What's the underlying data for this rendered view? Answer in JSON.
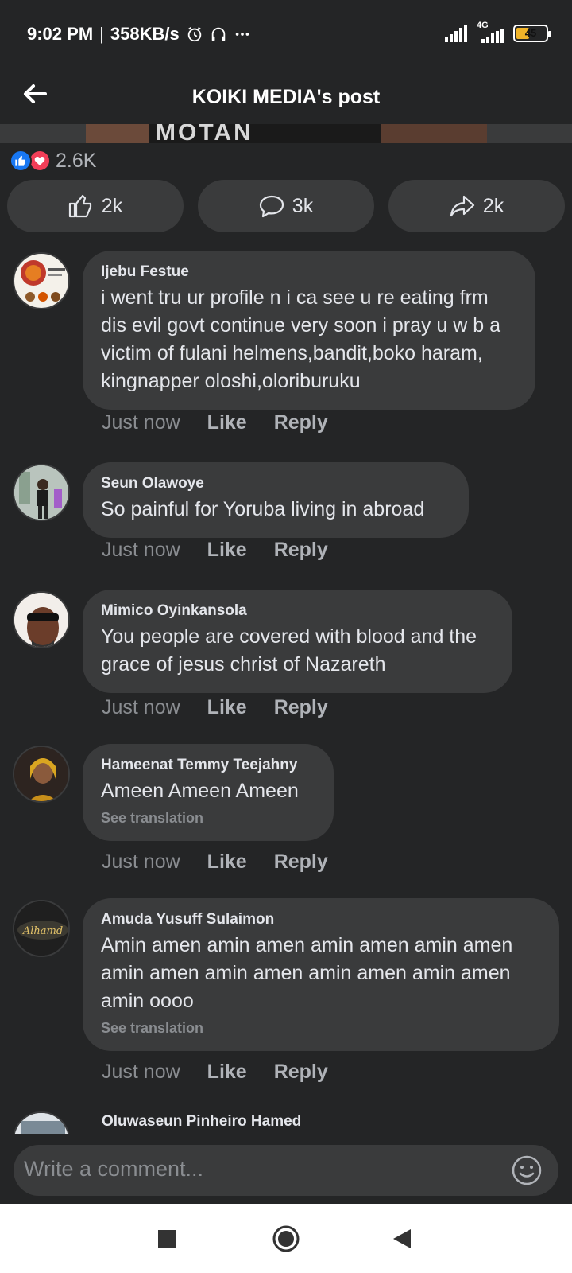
{
  "status_bar": {
    "time": "9:02 PM",
    "speed": "358KB/s",
    "network": "4G",
    "battery": "45",
    "battery_level": 0.45,
    "icons": [
      "alarm-icon",
      "headset-icon",
      "more-dots-icon",
      "signal-icon",
      "signal-4g-icon",
      "battery-icon"
    ]
  },
  "header": {
    "title": "KOIKI MEDIA's post",
    "back_icon": "arrow-left-icon"
  },
  "post_image": {
    "visible_text": "MOTAN"
  },
  "reactions": {
    "count": "2.6K",
    "types": [
      "like-icon",
      "love-icon"
    ]
  },
  "actions": {
    "like_count": "2k",
    "comment_count": "3k",
    "share_count": "2k"
  },
  "comments": [
    {
      "author": "Ijebu Festue",
      "text": "i went tru ur profile n i ca see u re eating frm dis evil govt continue very soon i pray u w b a victim of fulani helmens,bandit,boko haram, kingnapper oloshi,oloriburuku",
      "time": "Just now",
      "like": "Like",
      "reply": "Reply"
    },
    {
      "author": "Seun Olawoye",
      "text": "So painful for Yoruba living in abroad",
      "time": "Just now",
      "like": "Like",
      "reply": "Reply"
    },
    {
      "author": "Mimico Oyinkansola",
      "text": "You people are covered with blood and the grace of jesus christ of Nazareth",
      "time": "Just now",
      "like": "Like",
      "reply": "Reply"
    },
    {
      "author": "Hameenat Temmy Teejahny",
      "text": "Ameen Ameen Ameen",
      "translation": "See translation",
      "time": "Just now",
      "like": "Like",
      "reply": "Reply"
    },
    {
      "author": "Amuda Yusuff Sulaimon",
      "text": "Amin amen amin amen amin amen amin amen amin amen amin amen amin amen amin amen amin oooo",
      "translation": "See translation",
      "time": "Just now",
      "like": "Like",
      "reply": "Reply"
    },
    {
      "author": "Oluwaseun Pinheiro Hamed"
    }
  ],
  "composer": {
    "placeholder": "Write a comment...",
    "emoji_icon": "emoji-smile-icon"
  },
  "nav": {
    "recents_icon": "square-icon",
    "home_icon": "circle-icon",
    "back_icon": "triangle-back-icon"
  },
  "colors": {
    "background": "#242526",
    "bubble": "#3a3b3c",
    "like_blue": "#1877f2",
    "love_red": "#f33e58",
    "battery_yellow": "#f0b429"
  }
}
